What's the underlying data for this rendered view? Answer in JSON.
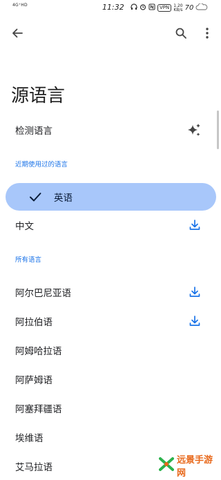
{
  "status_bar": {
    "network": "4G⁺HD",
    "time": "11:32",
    "vpn": "VPN",
    "speed_value": "1.20",
    "speed_unit": "KB/s",
    "battery": "70"
  },
  "page": {
    "title": "源语言"
  },
  "detect": {
    "label": "检测语言"
  },
  "recent_section": {
    "header": "近期使用过的语言",
    "selected_label": "英语",
    "items": [
      {
        "label": "中文",
        "downloadable": true
      }
    ]
  },
  "all_section": {
    "header": "所有语言",
    "items": [
      {
        "label": "阿尔巴尼亚语",
        "downloadable": true
      },
      {
        "label": "阿拉伯语",
        "downloadable": true
      },
      {
        "label": "阿姆哈拉语",
        "downloadable": false
      },
      {
        "label": "阿萨姆语",
        "downloadable": false
      },
      {
        "label": "阿塞拜疆语",
        "downloadable": false
      },
      {
        "label": "埃维语",
        "downloadable": false
      },
      {
        "label": "艾马拉语",
        "downloadable": false
      }
    ]
  },
  "watermark": {
    "text": "远景手游网"
  },
  "colors": {
    "accent": "#1a73e8",
    "selected_bg": "#a8c7fa",
    "watermark": "#e8681a"
  }
}
